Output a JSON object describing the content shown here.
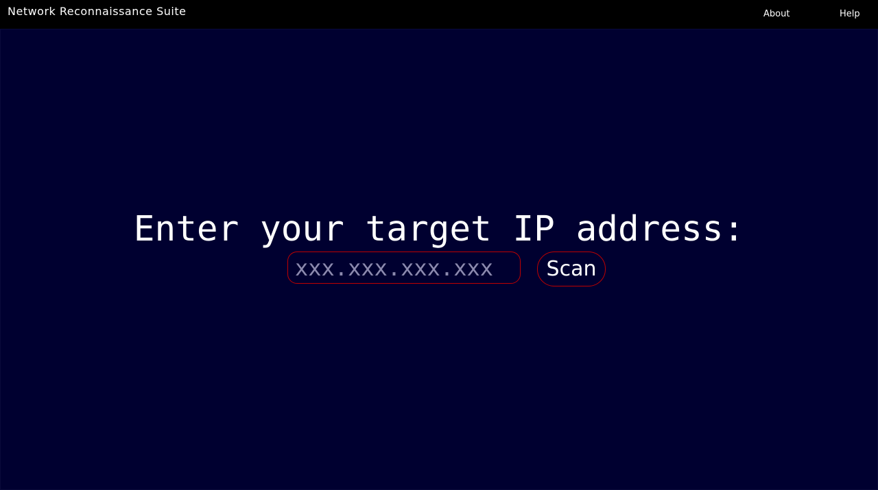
{
  "header": {
    "title": "Network Reconnaissance Suite",
    "nav": [
      "About",
      "Help"
    ]
  },
  "main": {
    "prompt": "Enter your target IP address:",
    "input_placeholder": "xxx.xxx.xxx.xxx",
    "scan_label": "Scan"
  },
  "colors": {
    "header_bg": "#000000",
    "main_bg": "#000030",
    "accent_border": "#c00000",
    "text": "#ffffff",
    "placeholder": "#8c8aae"
  }
}
